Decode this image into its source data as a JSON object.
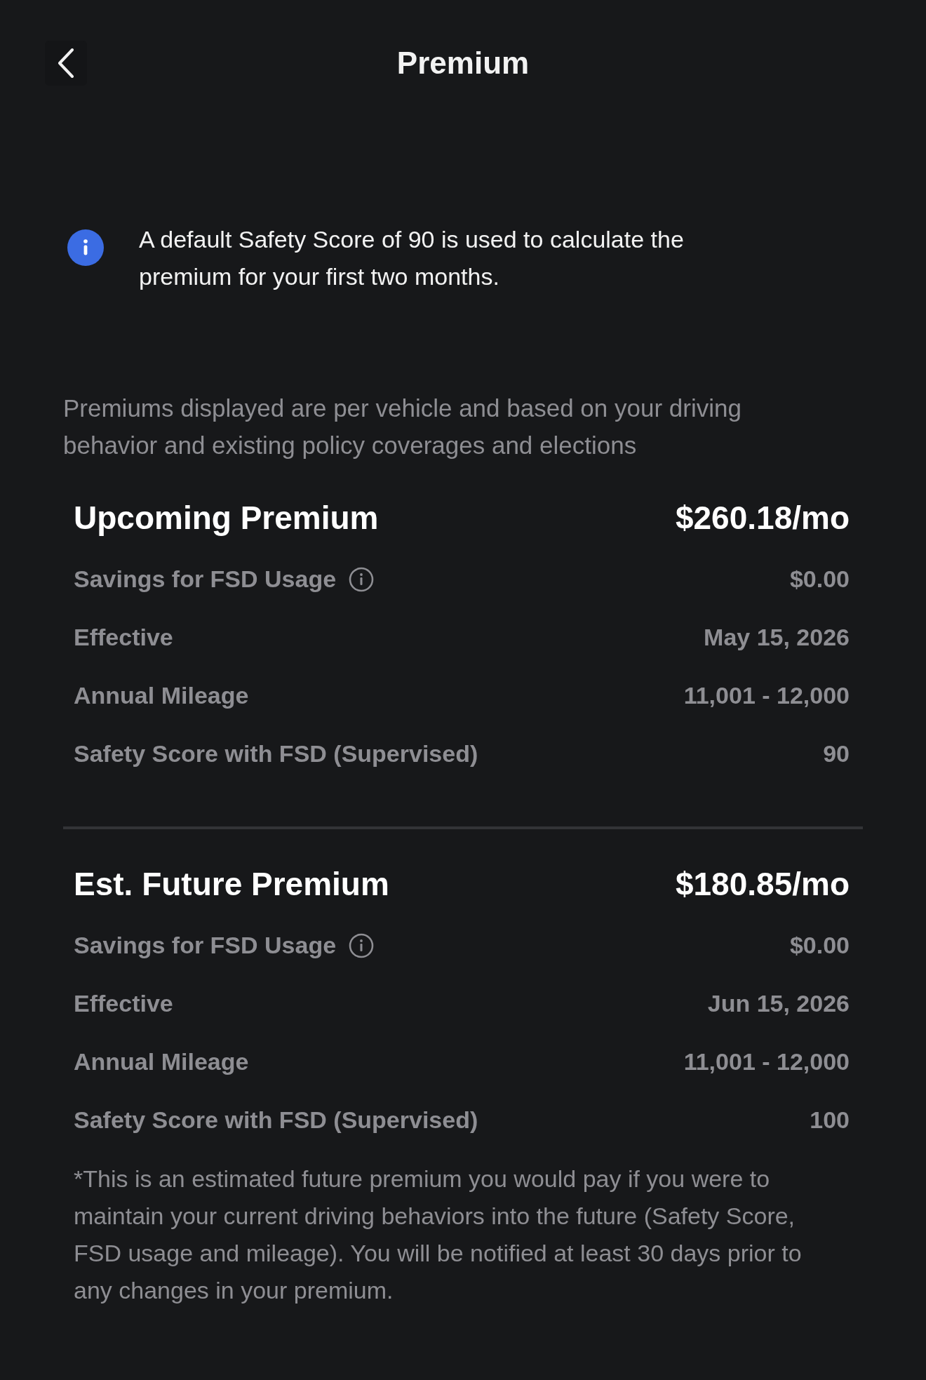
{
  "header": {
    "title": "Premium"
  },
  "notice": {
    "text": "A default Safety Score of 90 is used to calculate the premium for your first two months."
  },
  "disclaimer": "Premiums displayed are per vehicle and based on your driving behavior and existing policy coverages and elections",
  "sections": [
    {
      "title": "Upcoming Premium",
      "amount": "$260.18/mo",
      "rows": [
        {
          "label": "Savings for FSD Usage",
          "value": "$0.00",
          "has_info": true
        },
        {
          "label": "Effective",
          "value": "May 15, 2026",
          "has_info": false
        },
        {
          "label": "Annual Mileage",
          "value": "11,001 - 12,000",
          "has_info": false
        },
        {
          "label": "Safety Score with FSD (Supervised)",
          "value": "90",
          "has_info": false
        }
      ]
    },
    {
      "title": "Est. Future Premium",
      "amount": "$180.85/mo",
      "rows": [
        {
          "label": "Savings for FSD Usage",
          "value": "$0.00",
          "has_info": true
        },
        {
          "label": "Effective",
          "value": "Jun 15, 2026",
          "has_info": false
        },
        {
          "label": "Annual Mileage",
          "value": "11,001 - 12,000",
          "has_info": false
        },
        {
          "label": "Safety Score with FSD (Supervised)",
          "value": "100",
          "has_info": false
        }
      ]
    }
  ],
  "footnote": "*This is an estimated future premium you would pay if you were to maintain your current driving behaviors into the future (Safety Score, FSD usage and mileage). You will be notified at least 30 days prior to any changes in your premium."
}
